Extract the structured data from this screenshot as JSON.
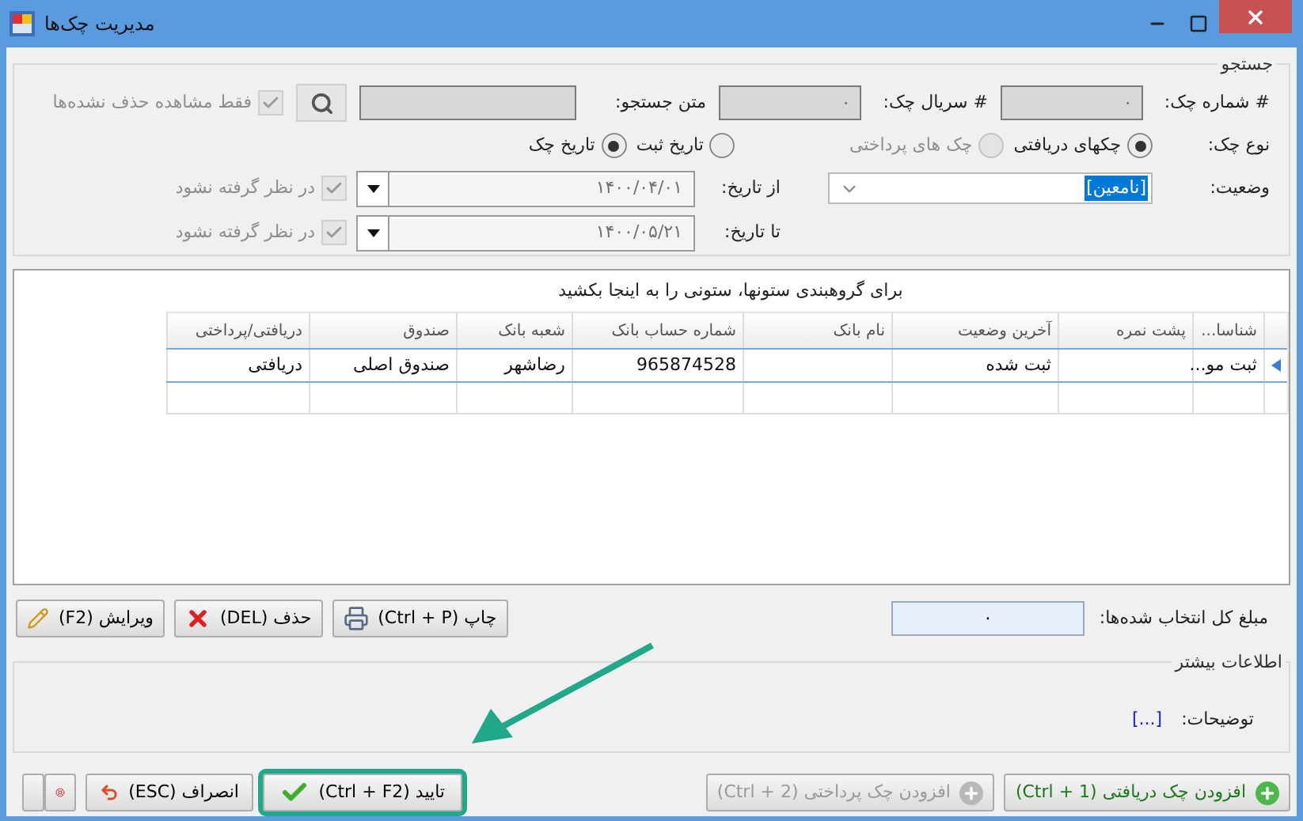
{
  "window": {
    "title": "مدیریت چک‌ها"
  },
  "search": {
    "legend": "جستجو",
    "fields": [
      {
        "label": "# شماره چک:",
        "value": "۰"
      },
      {
        "label": "# سریال چک:",
        "value": "۰"
      },
      {
        "label": "متن جستجو:"
      }
    ],
    "only_undeleted": {
      "label": "فقط مشاهده حذف نشده‌ها",
      "checked": true,
      "disabled": true
    },
    "check_type": {
      "label": "نوع چک:",
      "options": [
        {
          "label": "چکهای دریافتی",
          "selected": true,
          "disabled": false
        },
        {
          "label": "چک های پرداختی",
          "selected": false,
          "disabled": true
        }
      ]
    },
    "date_basis": [
      {
        "label": "تاریخ ثبت",
        "selected": false
      },
      {
        "label": "تاریخ چک",
        "selected": true
      }
    ],
    "status": {
      "label": "وضعیت:",
      "value": "[نامعین]"
    },
    "date_range": [
      {
        "label": "از تاریخ:",
        "value": "۱۴۰۰/۰۴/۰۱",
        "ignore": {
          "label": "در نظر گرفته نشود",
          "checked": true,
          "disabled": true
        }
      },
      {
        "label": "تا تاریخ:",
        "value": "۱۴۰۰/۰۵/۲۱",
        "ignore": {
          "label": "در نظر گرفته نشود",
          "checked": true,
          "disabled": true
        }
      }
    ]
  },
  "grid": {
    "group_hint": "برای گروهبندی ستونها، ستونی را به اینجا بکشید",
    "columns": [
      "شناسا...",
      "پشت نمره",
      "آخرین وضعیت",
      "نام بانک",
      "شماره حساب بانک",
      "شعبه بانک",
      "صندوق",
      "دریافتی/پرداختی"
    ],
    "rows": [
      {
        "current": true,
        "cells": [
          "ثبت مو...",
          null,
          "ثبت شده",
          null,
          "965874528",
          "رضاشهر",
          "صندوق اصلی",
          "دریافتی"
        ]
      }
    ]
  },
  "total": {
    "label": "مبلغ کل انتخاب شده‌ها:",
    "value": "۰"
  },
  "actions": [
    {
      "kind": "print",
      "label": "چاپ (Ctrl + P)"
    },
    {
      "kind": "delete",
      "label": "حذف (DEL)"
    },
    {
      "kind": "edit",
      "label": "ویرایش (F2)"
    }
  ],
  "more_info": {
    "legend": "اطلاعات بیشتر",
    "description_label": "توضیحات:",
    "description_link": "[...]"
  },
  "footer": {
    "right": [
      {
        "kind": "add",
        "label": "افزودن چک دریافتی (Ctrl + 1)",
        "disabled": false
      },
      {
        "kind": "add",
        "label": "افزودن چک پرداختی (Ctrl + 2)",
        "disabled": true
      }
    ],
    "left": [
      {
        "kind": "confirm",
        "label": "تایید (Ctrl + F2)",
        "highlighted": true
      },
      {
        "kind": "cancel",
        "label": "انصراف (ESC)",
        "highlighted": false
      },
      {
        "kind": "help",
        "highlighted": false
      },
      {
        "kind": "menu",
        "highlighted": false
      }
    ]
  }
}
